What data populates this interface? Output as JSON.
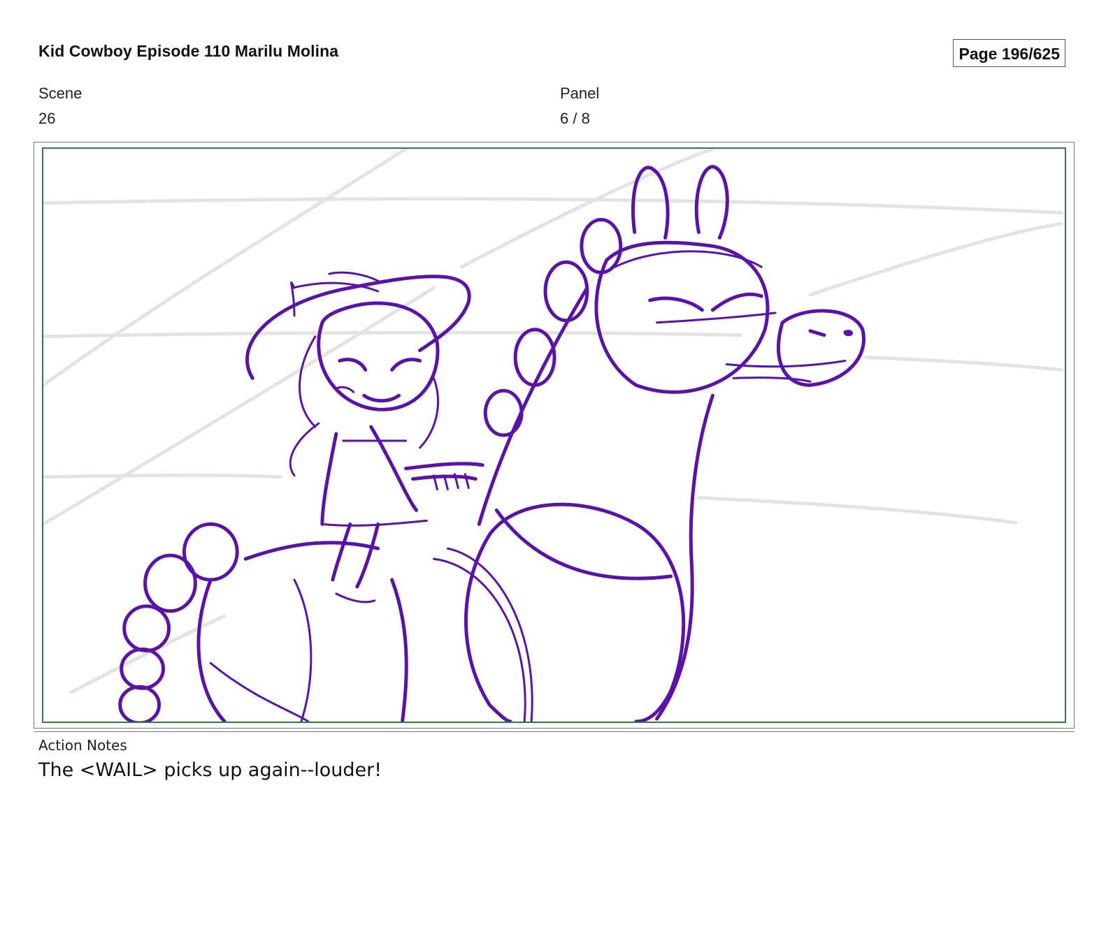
{
  "header": {
    "title": "Kid Cowboy Episode 110 Marilu Molina",
    "page": "Page 196/625"
  },
  "meta": {
    "scene_label": "Scene",
    "scene_value": "26",
    "panel_label": "Panel",
    "panel_value": "6 / 8"
  },
  "panel": {
    "image": "storyboard-sketch-cowgirl-riding-horse",
    "frame_color": "#2e7d32",
    "sketch_color": "#5a12a8"
  },
  "notes": {
    "label": "Action Notes",
    "text": "The <WAIL> picks up again--louder!"
  }
}
